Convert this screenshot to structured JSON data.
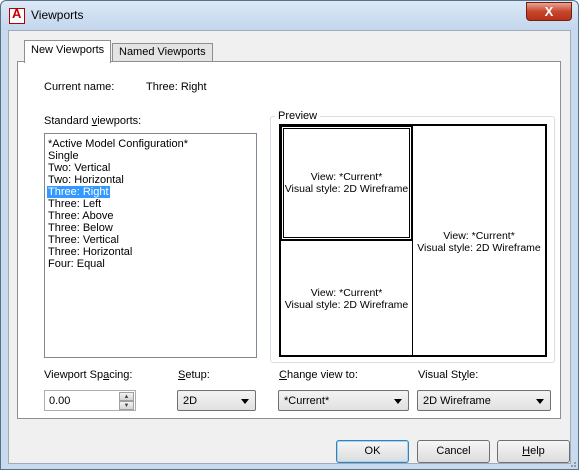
{
  "window": {
    "title": "Viewports",
    "close_glyph": "X",
    "app_icon_glyph": "A"
  },
  "tabs": [
    {
      "label": "New Viewports",
      "active": true
    },
    {
      "label": "Named Viewports",
      "active": false
    }
  ],
  "current_name": {
    "label": "Current name:",
    "value": "Three: Right"
  },
  "standard_viewports": {
    "label": "Standard viewports:",
    "items": [
      "*Active Model Configuration*",
      "Single",
      "Two:  Vertical",
      "Two:  Horizontal",
      "Three: Right",
      "Three: Left",
      "Three: Above",
      "Three: Below",
      "Three: Vertical",
      "Three: Horizontal",
      "Four:  Equal"
    ],
    "selected_index": 4
  },
  "preview": {
    "label": "Preview",
    "viewports": [
      {
        "line1": "View: *Current*",
        "line2": "Visual style: 2D Wireframe"
      },
      {
        "line1": "View: *Current*",
        "line2": "Visual style: 2D Wireframe"
      },
      {
        "line1": "View: *Current*",
        "line2": "Visual style: 2D Wireframe"
      }
    ]
  },
  "viewport_spacing": {
    "label": "Viewport Spacing:",
    "value": "0.00"
  },
  "setup": {
    "label": "Setup:",
    "value": "2D"
  },
  "change_view_to": {
    "label": "Change view to:",
    "value": "*Current*"
  },
  "visual_style": {
    "label": "Visual Style:",
    "value": "2D Wireframe"
  },
  "buttons": {
    "ok": "OK",
    "cancel": "Cancel",
    "help": "Help"
  },
  "colors": {
    "selection": "#3399ff",
    "close_button": "#c7462d"
  }
}
